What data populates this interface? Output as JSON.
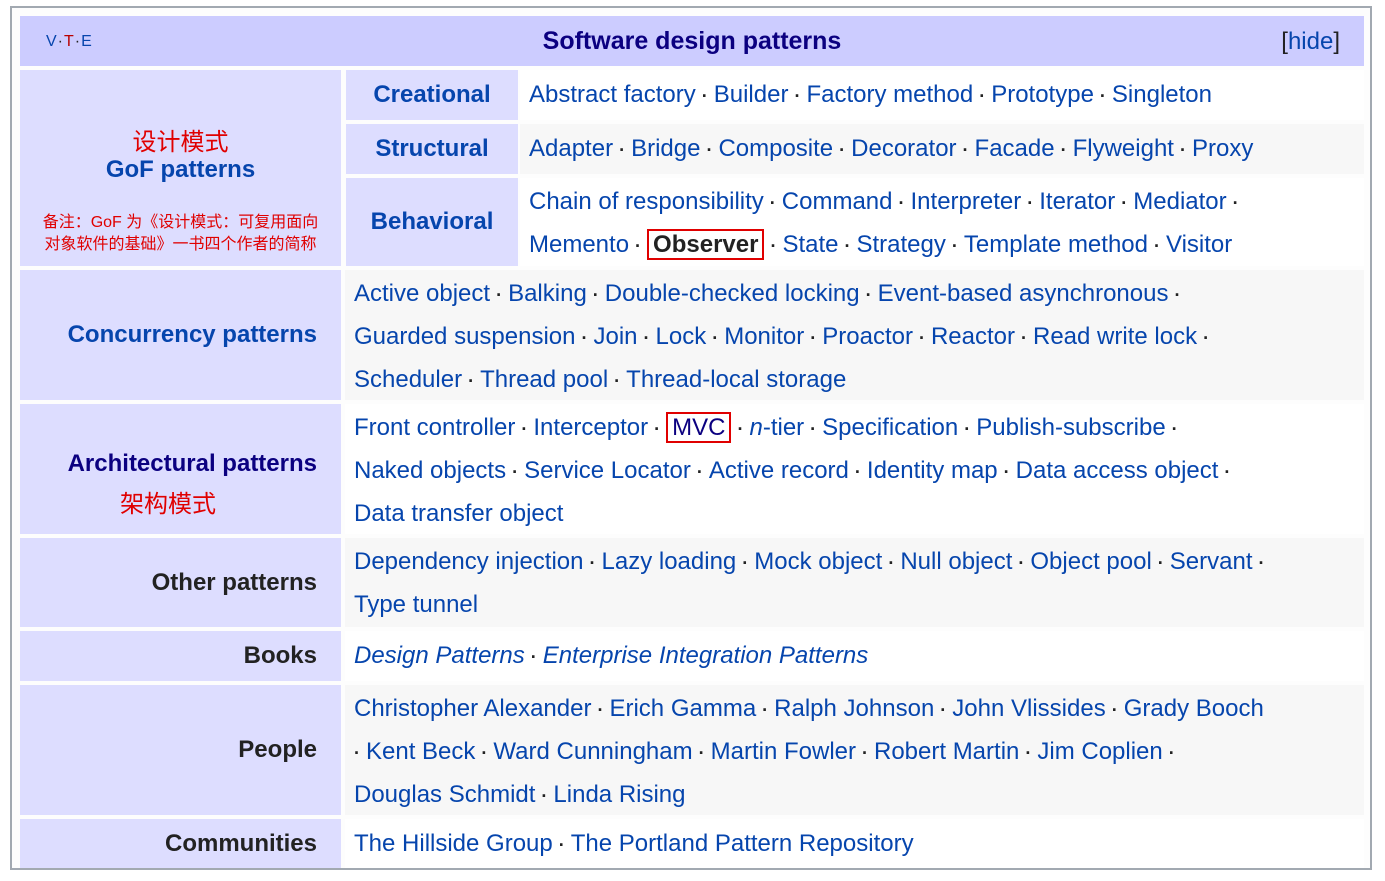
{
  "header": {
    "vte": [
      "V",
      "T",
      "E"
    ],
    "title": "Software design patterns",
    "hide_open": "[",
    "hide_label": "hide",
    "hide_close": "]"
  },
  "gof": {
    "cn_label": "设计模式",
    "label": "GoF patterns",
    "note_line1": "备注：GoF 为《设计模式：可复用面向",
    "note_line2": "对象软件的基础》一书四个作者的简称",
    "sub": [
      {
        "label": "Creational",
        "items": [
          "Abstract factory",
          "Builder",
          "Factory method",
          "Prototype",
          "Singleton"
        ]
      },
      {
        "label": "Structural",
        "items": [
          "Adapter",
          "Bridge",
          "Composite",
          "Decorator",
          "Facade",
          "Flyweight",
          "Proxy"
        ]
      },
      {
        "label": "Behavioral",
        "line1": [
          "Chain of responsibility",
          "Command",
          "Interpreter",
          "Iterator",
          "Mediator"
        ],
        "line2": [
          "Memento",
          "Observer",
          "State",
          "Strategy",
          "Template method",
          "Visitor"
        ]
      }
    ]
  },
  "concurrency": {
    "label": "Concurrency patterns",
    "line1": [
      "Active object",
      "Balking",
      "Double-checked locking",
      "Event-based asynchronous"
    ],
    "line2": [
      "Guarded suspension",
      "Join",
      "Lock",
      "Monitor",
      "Proactor",
      "Reactor",
      "Read write lock"
    ],
    "line3": [
      "Scheduler",
      "Thread pool",
      "Thread-local storage"
    ]
  },
  "architectural": {
    "label": "Architectural patterns",
    "cn_label": "架构模式",
    "line1": [
      "Front controller",
      "Interceptor",
      "MVC",
      "n",
      "-tier",
      "Specification",
      "Publish-subscribe"
    ],
    "line2": [
      "Naked objects",
      "Service Locator",
      "Active record",
      "Identity map",
      "Data access object"
    ],
    "line3": [
      "Data transfer object"
    ]
  },
  "other": {
    "label": "Other patterns",
    "line1": [
      "Dependency injection",
      "Lazy loading",
      "Mock object",
      "Null object",
      "Object pool",
      "Servant"
    ],
    "line2": [
      "Type tunnel"
    ]
  },
  "books": {
    "label": "Books",
    "items": [
      "Design Patterns",
      "Enterprise Integration Patterns"
    ]
  },
  "people": {
    "label": "People",
    "line1": [
      "Christopher Alexander",
      "Erich Gamma",
      "Ralph Johnson",
      "John Vlissides",
      "Grady Booch"
    ],
    "line2": [
      "Kent Beck",
      "Ward Cunningham",
      "Martin Fowler",
      "Robert Martin",
      "Jim Coplien"
    ],
    "line3": [
      "Douglas Schmidt",
      "Linda Rising"
    ]
  },
  "communities": {
    "label": "Communities",
    "items": [
      "The Hillside Group",
      "The Portland Pattern Repository"
    ]
  },
  "separator": "·",
  "colors": {
    "header_bg": "#ccccff",
    "group_bg": "#ddddff",
    "link": "#0645ad",
    "visited": "#0b0080",
    "highlight": "#e00000"
  }
}
